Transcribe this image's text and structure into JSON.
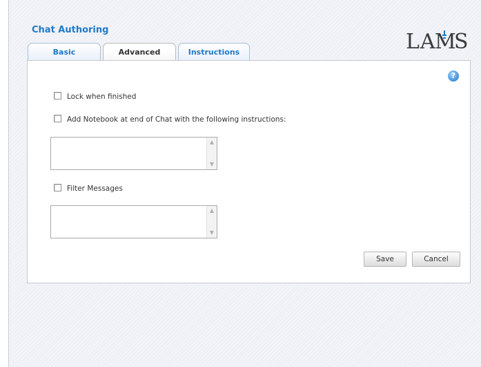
{
  "header": {
    "title": "Chat Authoring",
    "logo_text": "LAMS"
  },
  "tabs": [
    {
      "label": "Basic",
      "active": false
    },
    {
      "label": "Advanced",
      "active": true
    },
    {
      "label": "Instructions",
      "active": false
    }
  ],
  "panel": {
    "help_icon": "question-mark-icon",
    "help_glyph": "?",
    "lock_when_finished": {
      "label": "Lock when finished",
      "checked": false
    },
    "add_notebook": {
      "label": "Add Notebook at end of Chat with the following instructions:",
      "checked": false
    },
    "notebook_instructions": {
      "value": ""
    },
    "filter_messages": {
      "label": "Filter Messages",
      "checked": false
    },
    "filter_keywords": {
      "value": ""
    },
    "scroll_up_glyph": "▲",
    "scroll_down_glyph": "▼"
  },
  "actions": {
    "save_label": "Save",
    "cancel_label": "Cancel"
  },
  "colors": {
    "title": "#1e79c8",
    "tab_text": "#1e79c8",
    "active_tab_text": "#333333",
    "page_background": "#eef0f6"
  }
}
